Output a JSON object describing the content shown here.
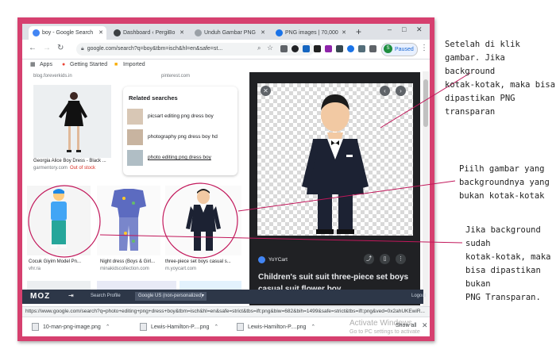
{
  "tabs": [
    {
      "label": "boy - Google Search",
      "active": true,
      "color": "#4285f4"
    },
    {
      "label": "Dashboard ‹ PergiBo",
      "active": false,
      "color": "#3c4043"
    },
    {
      "label": "Unduh Gambar PNG",
      "active": false,
      "color": "#9aa0a6"
    },
    {
      "label": "PNG images | 70,000",
      "active": false,
      "color": "#1a73e8"
    }
  ],
  "toolbar": {
    "url": "google.com/search?q=boy&tbm=isch&hl=en&safe=st...",
    "profile_initial": "S",
    "paused_label": "Paused"
  },
  "bookmarks": {
    "apps": "Apps",
    "getting_started": "Getting Started",
    "imported": "Imported"
  },
  "results": {
    "top_cap_1": "blog.foreverkids.in",
    "top_cap_2": "pinterest.com",
    "item1_title": "Georgia Alice Boy Dress - Black ...",
    "item1_source": "garmentory.com",
    "item1_stock": "Out of stock",
    "item2_title": "Cocuk Giyim Model Pn...",
    "item2_source": "vhr.ra",
    "item3_title": "Night dress (Boys & Girl...",
    "item3_source": "minakidscollection.com",
    "item4_title": "three-piece set boys casual s...",
    "item4_source": "m.yoycart.com"
  },
  "related": {
    "heading": "Related searches",
    "items": [
      "picsart editing png dress boy",
      "photography png dress boy hd",
      "photo editing png dress boy"
    ]
  },
  "preview": {
    "source": "YoYCart",
    "title": "Children's suit suit three-piece set boys casual suit flower boy ..."
  },
  "moz": {
    "logo": "MOZ",
    "search_profile": "Search Profile",
    "profile_select": "Google US (non-personalized)",
    "logout": "Logout"
  },
  "status_url": "https://www.google.com/search?q=photo+editing+png+dress+boy&tbm=isch&hl=en&safe=strict&tbs=ift:png&biw=682&bih=1499&safe=strict&tbs=ift:png&ved=0x2ahUKEwiR...",
  "downloads": [
    {
      "name": "10-man-png-image.png"
    },
    {
      "name": "Lewis-Hamilton-P....png"
    },
    {
      "name": "Lewis-Hamilton-P....png"
    }
  ],
  "show_all": "Show all",
  "watermark": {
    "line1": "Activate Windows",
    "line2": "Go to PC settings to activate Windows."
  },
  "annotations": {
    "a1": [
      "Setelah di klik",
      "gambar. Jika background",
      "kotak-kotak, maka bisa",
      "dipastikan PNG transparan"
    ],
    "a2": [
      "Piilh gambar yang",
      "backgroundnya yang",
      "bukan kotak-kotak"
    ],
    "a3": [
      "Jika background sudah",
      "kotak-kotak, maka",
      "bisa dipastikan bukan",
      "PNG Transparan."
    ]
  },
  "colors": {
    "frame": "#d6406f",
    "circle": "#c2185b",
    "panel": "#202124"
  }
}
